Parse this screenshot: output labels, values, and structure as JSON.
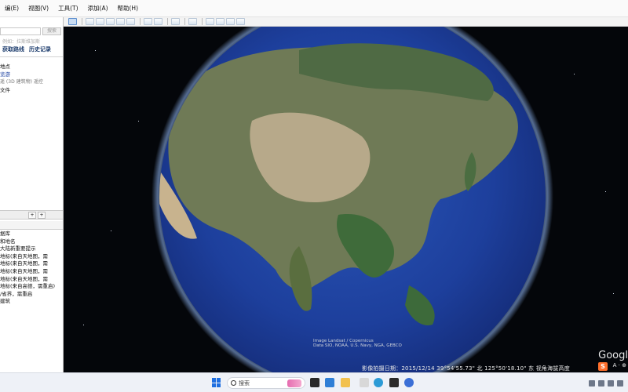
{
  "menu": {
    "items": [
      "编(E)",
      "视图(V)",
      "工具(T)",
      "添加(A)",
      "帮助(H)"
    ]
  },
  "search": {
    "placeholder": "",
    "button": "搜索",
    "hint": "  例如：拉斯维加斯"
  },
  "tabs": [
    "获取路线",
    "历史记录"
  ],
  "places": {
    "items": [
      {
        "label": "地点",
        "style": "normal"
      },
      {
        "label": "览游",
        "style": "blue"
      },
      {
        "label": "遥  (3D 建筑物) 遥控",
        "style": "sub"
      },
      {
        "label": "",
        "style": "normal"
      },
      {
        "label": "文件",
        "style": "normal"
      }
    ]
  },
  "places_controls": {
    "add": "+",
    "remove": "+"
  },
  "layers": {
    "items": [
      "据库",
      "",
      "和地名",
      "大陆新重要提示",
      "地标(来自天地图，需",
      "地标(来自天地图，需",
      "地标(来自天地图，需",
      "地标(来自天地图，需",
      "地标(来自高德，需重启)",
      "/省界，需重启",
      "",
      "",
      "建筑",
      ""
    ]
  },
  "viewer": {
    "attribution": "Data SIO, NOAA, U.S. Navy, NGA, GEBCO",
    "attribution2": "Image Landsat / Copernicus",
    "status": "影像拍摄日期：2015/12/14   39°54'55.73\" 北  125°50'18.10\" 东  视角海拔高度",
    "logo": "Googl",
    "ime": "A  ·  ⊕"
  },
  "taskbar": {
    "search_label": "搜索"
  },
  "colors": {
    "space": "#04060a",
    "ocean": "#1f3f9a",
    "accent": "#1f6fe0"
  }
}
